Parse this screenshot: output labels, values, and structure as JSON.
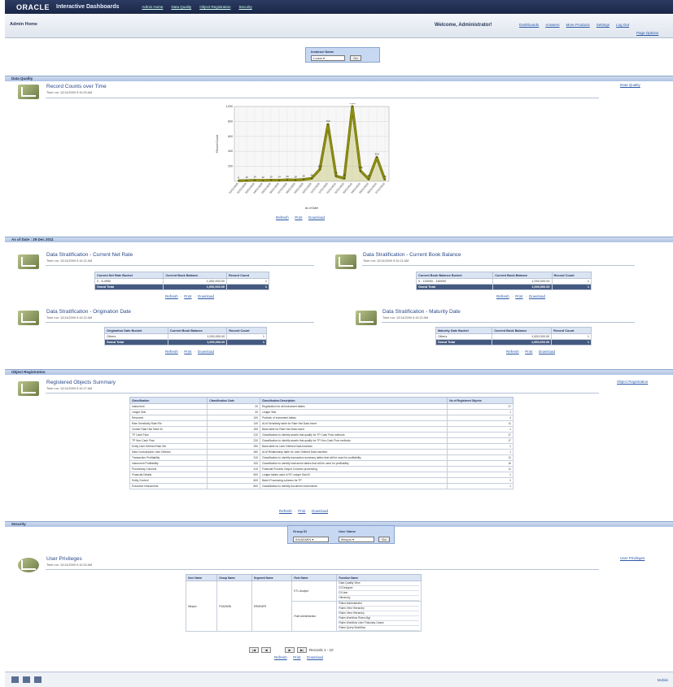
{
  "header": {
    "logo": "ORACLE",
    "app_name": "Interactive Dashboards",
    "tabs": [
      "Admin Home",
      "Data Quality",
      "Object Registration",
      "Security"
    ],
    "dashboard_name": "Admin Home",
    "welcome": "Welcome, Administrator!",
    "links": [
      "Dashboards",
      "Answers",
      "More Products",
      "Settings",
      "Log Out"
    ],
    "page_options": "Page Options"
  },
  "instance_prompt": {
    "label": "Instance Name",
    "value": "Loans",
    "go": "Go"
  },
  "sections": {
    "data_quality": "Data Quality",
    "as_of": "As of Date : 29 Dec 2011",
    "object_registration": "Object Registration",
    "security": "Security"
  },
  "record_counts": {
    "title": "Record Counts over Time",
    "subtitle": "Time run: 12/14/2009 9:10:20 AM",
    "side_link": "Data Quality",
    "xlabel": "As of Date",
    "ylabel": "Record Count",
    "links": [
      "Refresh",
      "Print",
      "Download"
    ]
  },
  "chart_data": {
    "type": "line",
    "title": "",
    "xlabel": "As of Date",
    "ylabel": "Record Count",
    "ylim": [
      0,
      1000
    ],
    "yticks": [
      "1,000",
      "800",
      "600",
      "400",
      "200"
    ],
    "x": [
      "01/01/2009",
      "02/01/2009",
      "03/01/2009",
      "04/01/2009",
      "05/01/2009",
      "06/01/2009",
      "07/01/2009",
      "08/01/2009",
      "09/01/2009",
      "10/01/2009",
      "11/01/2009",
      "12/01/2009",
      "01/01/2010",
      "02/01/2010",
      "03/01/2010",
      "04/01/2010",
      "05/01/2010",
      "06/01/2010",
      "07/01/2010"
    ],
    "series": [
      {
        "name": "",
        "values": [
          8,
          10,
          14,
          12,
          15,
          14,
          20,
          18,
          25,
          40,
          160,
          760,
          70,
          40,
          1000,
          140,
          30,
          320,
          20
        ],
        "labels": [
          "8",
          "10",
          "14",
          "12",
          "15",
          "14",
          "20",
          "18",
          "25",
          "40",
          "160",
          "760",
          "70",
          "40",
          "1,000",
          "140",
          "30",
          "320",
          "20"
        ]
      }
    ],
    "color": "#8c8d12",
    "grid": true
  },
  "strat_current_rate": {
    "title": "Data Stratification - Current Net Rate",
    "subtitle": "Time run: 12/14/2009 9:10:21 AM",
    "columns": [
      "Current Net Rate Bucket",
      "Current Book Balance",
      "Record Count"
    ],
    "rows": [
      [
        "0 - 8.4950",
        "1,000,000.00",
        "1"
      ]
    ],
    "total": [
      "Grand Total",
      "1,000,000.00",
      "1"
    ],
    "links": [
      "Refresh",
      "Print",
      "Download"
    ]
  },
  "strat_book_balance": {
    "title": "Data Stratification - Current Book Balance",
    "subtitle": "Time run: 12/14/2009 9:10:21 AM",
    "columns": [
      "Current Book Balance Bucket",
      "Current Book Balance",
      "Record Count"
    ],
    "rows": [
      [
        "0 - 100000 - 180000",
        "1,000,000.00",
        "1"
      ]
    ],
    "total": [
      "Grand Total",
      "1,000,000.00",
      "1"
    ],
    "links": [
      "Refresh",
      "Print",
      "Download"
    ]
  },
  "strat_origination": {
    "title": "Data Stratification - Origination Date",
    "subtitle": "Time run: 12/14/2009 9:10:22 AM",
    "columns": [
      "Origination Date Bucket",
      "Current Book Balance",
      "Record Count"
    ],
    "rows": [
      [
        "Others",
        "1,000,000.00",
        "1"
      ]
    ],
    "total": [
      "Grand Total",
      "1,000,000.00",
      "1"
    ],
    "links": [
      "Refresh",
      "Print",
      "Download"
    ]
  },
  "strat_maturity": {
    "title": "Data Stratification - Maturity Date",
    "subtitle": "Time run: 12/14/2009 9:10:22 AM",
    "columns": [
      "Maturity Date Bucket",
      "Current Book Balance",
      "Record Count"
    ],
    "rows": [
      [
        "Others",
        "1,000,000.00",
        "1"
      ]
    ],
    "total": [
      "Grand Total",
      "1,000,000.00",
      "1"
    ],
    "links": [
      "Refresh",
      "Print",
      "Download"
    ]
  },
  "registered_objects": {
    "title": "Registered Objects Summary",
    "subtitle": "Time run: 12/14/2009 9:10:27 AM",
    "side_link": "Object Registration",
    "columns": [
      "Classification",
      "Classification Code",
      "Classification Description",
      "No of Registered Objects"
    ],
    "rows": [
      [
        "Instrument",
        "20",
        "Registration for all instrument tables",
        "17"
      ],
      [
        "Ledger Stat",
        "30",
        "Ledger Stat",
        "1"
      ],
      [
        "Reserved",
        "100",
        "Portfolio of instrument tables",
        "4"
      ],
      [
        "Rate Sensitivity Rate File",
        "140",
        "ALM Sensitivity table for Rate Hist Data Insert",
        "11"
      ],
      [
        "Cluster Rate Hist Table ID",
        "150",
        "Base table for Rate Hist Data Insert",
        "1"
      ],
      [
        "TP Cash Flow",
        "210",
        "Classification to identify assets that qualify for TP Cash Flow methods",
        "17"
      ],
      [
        "TP Non-Cash Flow",
        "220",
        "Classification to identify assets that qualify for TP Non-Cash Flow methods",
        "17"
      ],
      [
        "Entity User Defined Rate Set",
        "250",
        "Base table for User Defined Data Insertion",
        "1"
      ],
      [
        "Data Consumption User Defined",
        "260",
        "ALM Relationship table for User Defined Data Insertion",
        "1"
      ],
      [
        "Transaction Profitability",
        "310",
        "Classification to identify transaction summary tables that will be used for profitability",
        "11"
      ],
      [
        "Instrument Profitability",
        "320",
        "Classification to identify instrument tables that will be used for profitability",
        "16"
      ],
      [
        "Processing Columns",
        "410",
        "Financial Process Output Columns processing",
        "11"
      ],
      [
        "Financial Details",
        "500",
        "Ledger tables used in FE Ledger Stat ID",
        "1"
      ],
      [
        "Entity Context",
        "600",
        "Batch Processing columns for TP",
        "1"
      ],
      [
        "Executive Instruments",
        "800",
        "Classification to identify document instruments",
        "1"
      ]
    ],
    "links": [
      "Refresh",
      "Print",
      "Download"
    ]
  },
  "security_prompt": {
    "group_label": "Group ID",
    "group_value": "INVADMIN",
    "user_label": "User Name",
    "user_value": "Iftespio",
    "go": "Go"
  },
  "user_privileges": {
    "title": "User Privileges",
    "subtitle": "Time run: 12/14/2009 9:10:32 AM",
    "side_link": "User Privileges",
    "columns": [
      "User Name",
      "Group Name",
      "Segment Name",
      "Role Name",
      "Function Name"
    ],
    "user": "Iftespio",
    "group": "FSADMIN",
    "segment": "ERMINER",
    "roles": [
      "ETL Analyst",
      "Rule Administrator"
    ],
    "functions_1": [
      "Data Quality View",
      "DI Designer",
      "DI User",
      "Hierarchy"
    ],
    "functions_2": [
      "Rules Administrator",
      "Rules View Hierarchy",
      "Rules View Hierarchy",
      "Rules Workflow Rules Mgt",
      "Rules Workflow User Fiduciary Cases",
      "Rules Query Workflow"
    ],
    "pager_text": "Records 1 - 10",
    "links": [
      "Refresh",
      "Print",
      "Download"
    ]
  },
  "footer": {
    "right_text": "Mobile"
  }
}
